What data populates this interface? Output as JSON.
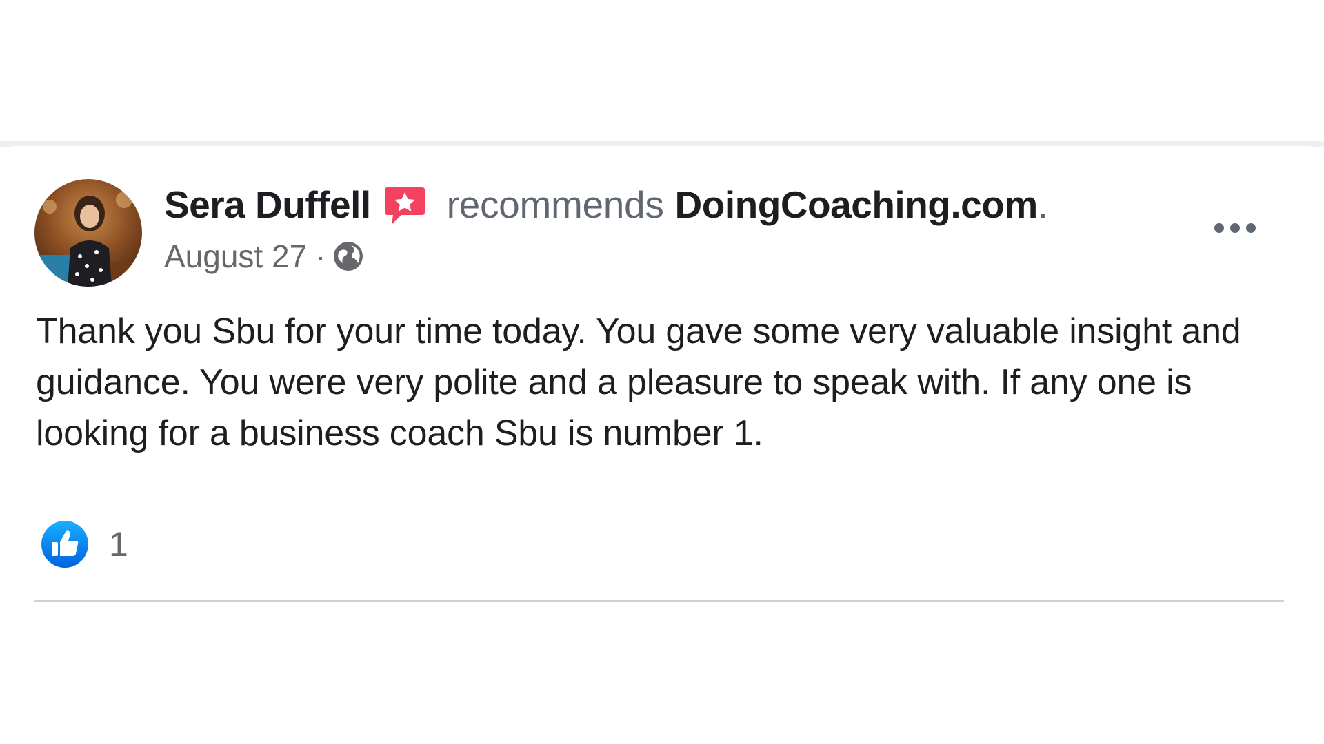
{
  "post": {
    "author_name": "Sera Duffell",
    "recommends_word": "recommends",
    "page_name": "DoingCoaching.com",
    "page_name_suffix": ".",
    "date": "August 27",
    "meta_separator": "·",
    "audience_icon": "globe-icon",
    "badge_icon": "recommendation-star-icon",
    "more_icon": "more-options-icon",
    "body": "Thank you Sbu for your time today. You gave some very valuable insight and guidance. You were very polite and a pleasure to speak with. If any one is looking for a business coach Sbu is number 1."
  },
  "reactions": {
    "icon": "like-thumbs-up-icon",
    "count": "1"
  },
  "colors": {
    "like_blue": "#1877f2",
    "badge_red": "#f3425f",
    "text_primary": "#1c1e21",
    "text_secondary": "#65676b",
    "divider": "#ced0d4"
  }
}
